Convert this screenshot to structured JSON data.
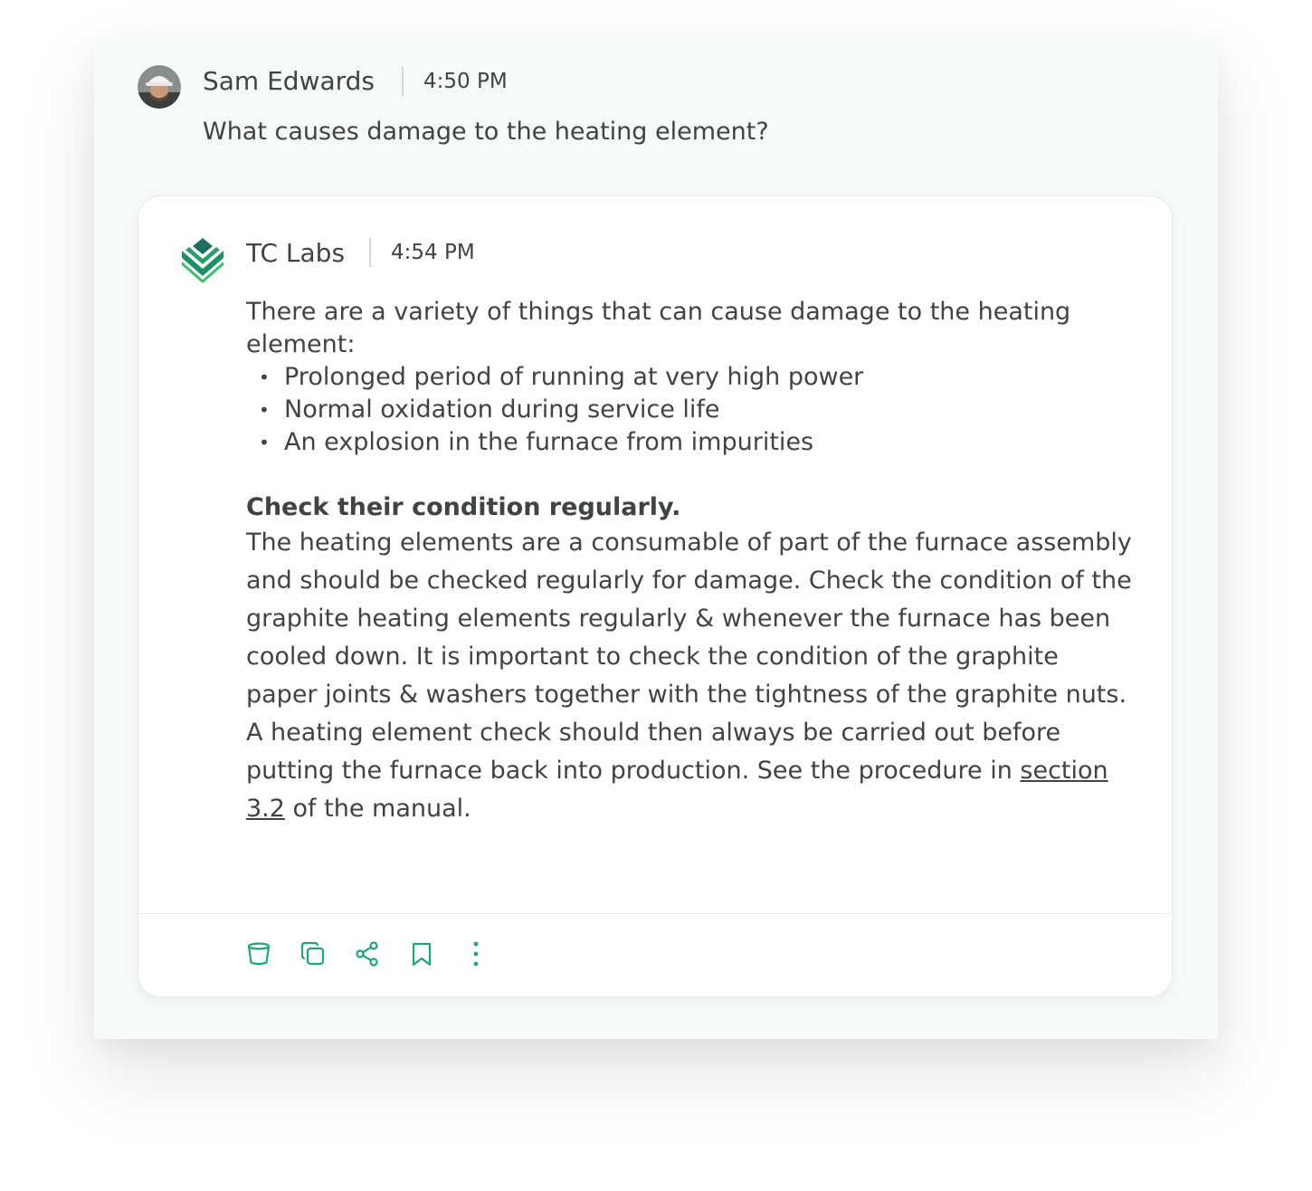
{
  "user_message": {
    "name": "Sam Edwards",
    "time": "4:50 PM",
    "text": "What causes damage to the heating element?"
  },
  "bot_message": {
    "name": "TC Labs",
    "time": "4:54 PM",
    "intro": "There are a variety of things that can cause damage to the heating element:",
    "bullets": [
      "Prolonged period of running at very high power",
      "Normal oxidation during service life",
      "An explosion in the furnace from impurities"
    ],
    "heading": "Check their condition regularly.",
    "paragraph1": "The heating elements are a consumable of part of the furnace assembly and should be checked regularly for damage. Check the condition of the graphite heating elements regularly & whenever the furnace has been cooled down. It is important to check the condition of the graphite paper joints & washers together with the tightness of the graphite nuts.",
    "paragraph2_pre": "A heating element check should then always be carried out before putting the furnace back into production. See the procedure in ",
    "paragraph2_link": "section 3.2",
    "paragraph2_post": " of the manual."
  },
  "actions": [
    {
      "icon": "bucket-icon"
    },
    {
      "icon": "copy-icon"
    },
    {
      "icon": "share-icon"
    },
    {
      "icon": "bookmark-icon"
    },
    {
      "icon": "more-vertical-icon"
    }
  ],
  "colors": {
    "accent": "#1ea672",
    "text": "#3f4441",
    "panel_bg": "#f7fafa"
  }
}
